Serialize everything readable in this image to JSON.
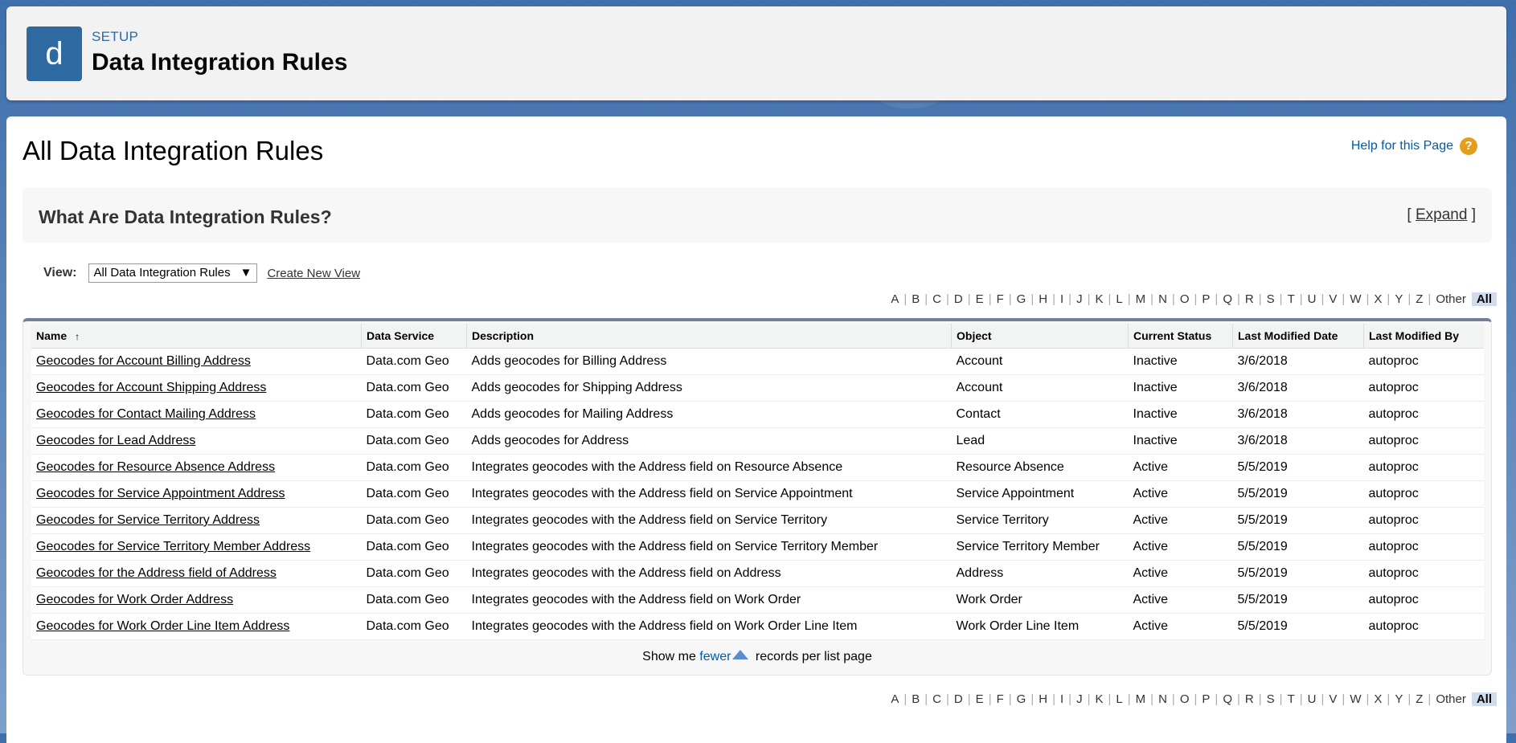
{
  "header": {
    "logo_letter": "d",
    "section": "SETUP",
    "title": "Data Integration Rules"
  },
  "page": {
    "title": "All Data Integration Rules",
    "help_link": "Help for this Page",
    "help_icon": "?"
  },
  "info": {
    "title": "What Are Data Integration Rules?",
    "expand_open": "[",
    "expand_label": "Expand",
    "expand_close": "]"
  },
  "view": {
    "label": "View:",
    "selected": "All Data Integration Rules",
    "create_new": "Create New View"
  },
  "alphabet": [
    "A",
    "B",
    "C",
    "D",
    "E",
    "F",
    "G",
    "H",
    "I",
    "J",
    "K",
    "L",
    "M",
    "N",
    "O",
    "P",
    "Q",
    "R",
    "S",
    "T",
    "U",
    "V",
    "W",
    "X",
    "Y",
    "Z",
    "Other"
  ],
  "alphabet_all": "All",
  "table": {
    "columns": [
      "Name",
      "Data Service",
      "Description",
      "Object",
      "Current Status",
      "Last Modified Date",
      "Last Modified By"
    ],
    "rows": [
      [
        "Geocodes for Account Billing Address",
        "Data.com Geo",
        "Adds geocodes for Billing Address",
        "Account",
        "Inactive",
        "3/6/2018",
        "autoproc"
      ],
      [
        "Geocodes for Account Shipping Address",
        "Data.com Geo",
        "Adds geocodes for Shipping Address",
        "Account",
        "Inactive",
        "3/6/2018",
        "autoproc"
      ],
      [
        "Geocodes for Contact Mailing Address",
        "Data.com Geo",
        "Adds geocodes for Mailing Address",
        "Contact",
        "Inactive",
        "3/6/2018",
        "autoproc"
      ],
      [
        "Geocodes for Lead Address",
        "Data.com Geo",
        "Adds geocodes for Address",
        "Lead",
        "Inactive",
        "3/6/2018",
        "autoproc"
      ],
      [
        "Geocodes for Resource Absence Address",
        "Data.com Geo",
        "Integrates geocodes with the Address field on Resource Absence",
        "Resource Absence",
        "Active",
        "5/5/2019",
        "autoproc"
      ],
      [
        "Geocodes for Service Appointment Address",
        "Data.com Geo",
        "Integrates geocodes with the Address field on Service Appointment",
        "Service Appointment",
        "Active",
        "5/5/2019",
        "autoproc"
      ],
      [
        "Geocodes for Service Territory Address",
        "Data.com Geo",
        "Integrates geocodes with the Address field on Service Territory",
        "Service Territory",
        "Active",
        "5/5/2019",
        "autoproc"
      ],
      [
        "Geocodes for Service Territory Member Address",
        "Data.com Geo",
        "Integrates geocodes with the Address field on Service Territory Member",
        "Service Territory Member",
        "Active",
        "5/5/2019",
        "autoproc"
      ],
      [
        "Geocodes for the Address field of Address",
        "Data.com Geo",
        "Integrates geocodes with the Address field on Address",
        "Address",
        "Active",
        "5/5/2019",
        "autoproc"
      ],
      [
        "Geocodes for Work Order Address",
        "Data.com Geo",
        "Integrates geocodes with the Address field on Work Order",
        "Work Order",
        "Active",
        "5/5/2019",
        "autoproc"
      ],
      [
        "Geocodes for Work Order Line Item Address",
        "Data.com Geo",
        "Integrates geocodes with the Address field on Work Order Line Item",
        "Work Order Line Item",
        "Active",
        "5/5/2019",
        "autoproc"
      ]
    ]
  },
  "pager": {
    "prefix": "Show me",
    "link": "fewer",
    "suffix": "records per list page"
  }
}
